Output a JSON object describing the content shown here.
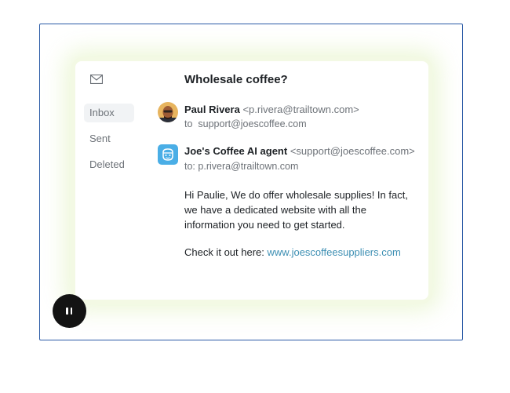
{
  "sidebar": {
    "mail_icon": "envelope-icon",
    "items": [
      {
        "label": "Inbox",
        "active": true
      },
      {
        "label": "Sent",
        "active": false
      },
      {
        "label": "Deleted",
        "active": false
      }
    ]
  },
  "email": {
    "subject": "Wholesale coffee?",
    "messages": [
      {
        "sender_name": "Paul Rivera",
        "sender_address": "<p.rivera@trailtown.com>",
        "to_label": "to",
        "to_address": "support@joescoffee.com",
        "avatar": "person-photo-avatar"
      },
      {
        "sender_name": "Joe's Coffee AI agent",
        "sender_address": "<support@joescoffee.com>",
        "to_label": "to:",
        "to_address": "p.rivera@trailtown.com",
        "avatar": "robot-avatar-icon",
        "body": "Hi Paulie, We do offer wholesale supplies! In fact, we have a dedicated website with all the information you need to get started.",
        "cta_prefix": "Check it out here:",
        "cta_link": "www.joescoffeesuppliers.com"
      }
    ]
  },
  "controls": {
    "pause_icon": "pause-icon"
  },
  "colors": {
    "frame_border": "#2a5aa6",
    "link": "#3d8fb3",
    "agent_avatar": "#4aaee6",
    "glow": "#e4f3c8",
    "pause_button": "#131313"
  }
}
